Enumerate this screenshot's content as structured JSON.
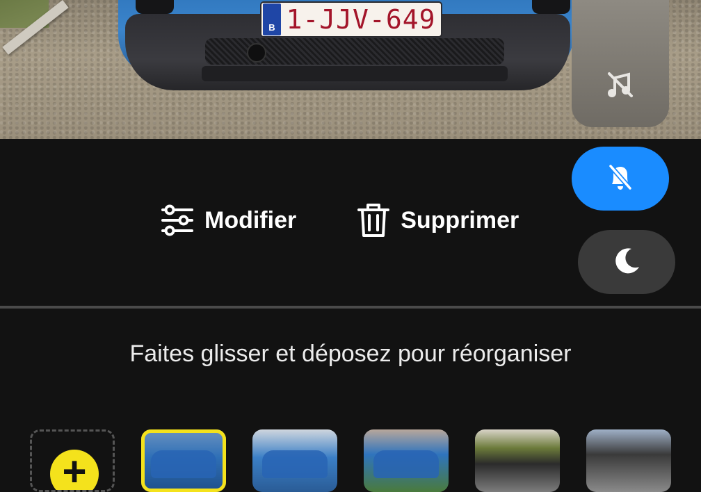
{
  "photo": {
    "plate_country": "B",
    "plate_text": "1-JJV-649"
  },
  "actions": {
    "edit_label": "Modifier",
    "delete_label": "Supprimer"
  },
  "hint": "Faites glisser et déposez pour réorganiser",
  "thumbnails": {
    "add_symbol": "+",
    "items": [
      {
        "name": "car-front",
        "selected": true
      },
      {
        "name": "car-side",
        "selected": false
      },
      {
        "name": "car-rear",
        "selected": false
      },
      {
        "name": "car-dashboard",
        "selected": false
      },
      {
        "name": "car-interior",
        "selected": false
      }
    ]
  },
  "quick_controls": {
    "music_icon": "music-off-icon",
    "bell_icon": "bell-off-icon",
    "moon_icon": "moon-icon",
    "accent_color": "#1a8cff",
    "highlight_color": "#f4e21c"
  }
}
